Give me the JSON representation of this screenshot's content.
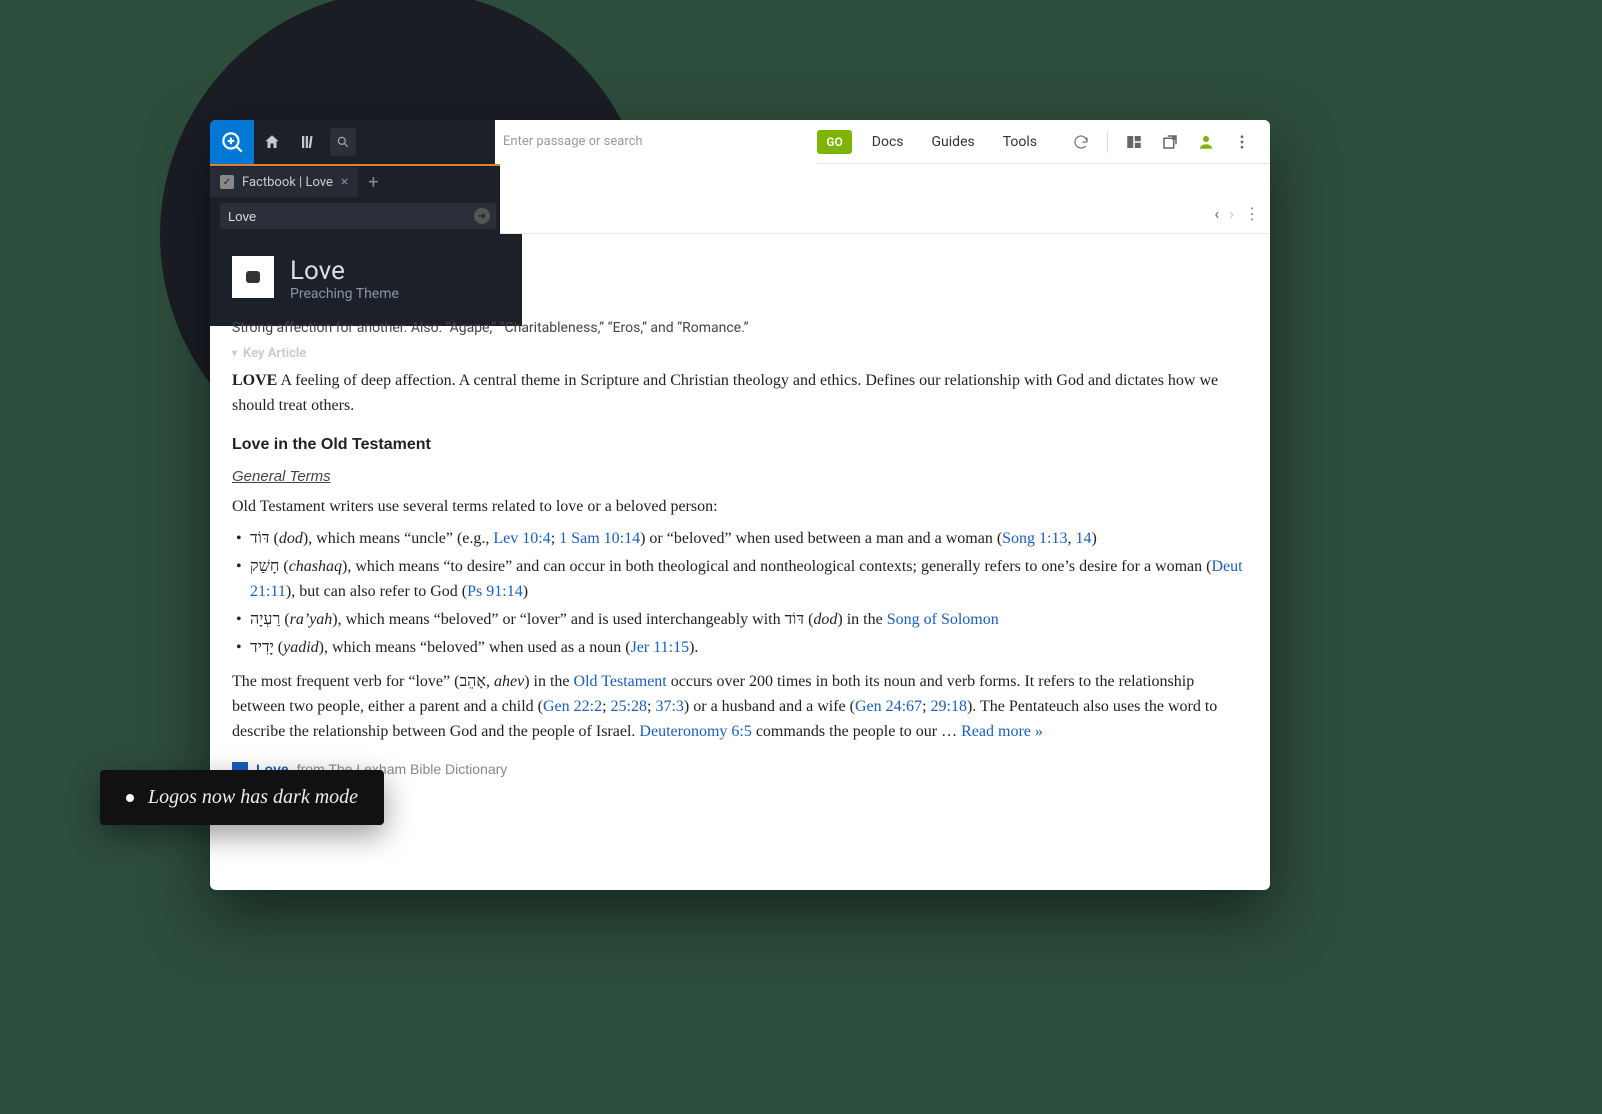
{
  "toolbar": {
    "search_placeholder": "Enter passage or search",
    "go_label": "GO",
    "menu": {
      "docs": "Docs",
      "guides": "Guides",
      "tools": "Tools"
    }
  },
  "tab": {
    "label": "Factbook | Love"
  },
  "search": {
    "value": "Love"
  },
  "topic": {
    "title": "Love",
    "subtitle": "Preaching Theme",
    "description": "Strong affection for another. Also: “Agape,” “Charitableness,” “Eros,” and “Romance.”"
  },
  "section": {
    "key_article": "Key Article"
  },
  "article": {
    "lead_word": "LOVE",
    "lead_rest": " A feeling of deep affection. A central theme in Scripture and Christian theology and ethics. Defines our relationship with God and dictates how we should treat others.",
    "h_ot": "Love in the Old Testament",
    "h_general": "General Terms",
    "intro_line": "Old Testament writers use several terms related to love or a beloved person:",
    "b1": {
      "heb": "דּוֹד",
      "trans": "dod",
      "pre": ", which means “uncle” (e.g., ",
      "ref1": "Lev 10:4",
      "sep1": "; ",
      "ref2": "1 Sam 10:14",
      "post1": ") or “beloved” when used between a man and a woman (",
      "ref3": "Song 1:13",
      "sep2": ", ",
      "ref4": "14",
      "post2": ")"
    },
    "b2": {
      "heb": "חָשַׁק",
      "trans": "chashaq",
      "text1": ", which means “to desire” and can occur in both theological and nontheological contexts; generally refers to one’s desire for a woman (",
      "ref1": "Deut 21:11",
      "text2": "), but can also refer to God (",
      "ref2": "Ps 91:14",
      "text3": ")"
    },
    "b3": {
      "heb": "רַעְיָה",
      "trans": "ra’yah",
      "text1": ", which means “beloved” or “lover” and is used interchangeably with ",
      "heb2": "דּוֹד",
      "trans2": "dod",
      "text2": " in the ",
      "ref1": "Song of Solomon"
    },
    "b4": {
      "heb": "יָדִיד",
      "trans": "yadid",
      "text1": ", which means “beloved” when used as a noun (",
      "ref1": "Jer 11:15",
      "text2": ")."
    },
    "para": {
      "p1": "The most frequent verb for “love” (",
      "heb": "אָהֵב",
      "trans": "ahev",
      "p2": ") in the ",
      "ref_ot": "Old Testament",
      "p3": " occurs over 200 times in both its noun and verb forms. It refers to the relationship between two people, either a parent and a child (",
      "ref1": "Gen 22:2",
      "s1": "; ",
      "ref2": "25:28",
      "s2": "; ",
      "ref3": "37:3",
      "p4": ") or a husband and a wife (",
      "ref4": "Gen 24:67",
      "s3": "; ",
      "ref5": "29:18",
      "p5": "). The Pentateuch also uses the word to describe the relationship between God and the people of Israel. ",
      "ref6": "Deuteronomy 6:5",
      "p6": " commands the people to our … ",
      "readmore": "Read more »"
    }
  },
  "source": {
    "link": "Love",
    "from": "from The Lexham Bible Dictionary"
  },
  "caption": "Logos now has dark mode"
}
